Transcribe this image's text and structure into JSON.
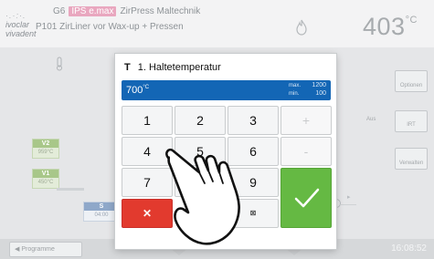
{
  "header": {
    "logo_line1": "ivoclar",
    "logo_line2": "vivadent",
    "program_prefix": "G6",
    "brand_badge": "IPS e.max",
    "program_title": "ZirPress Maltechnik",
    "program_number": "P101",
    "program_subtitle": "ZirLiner vor Wax-up + Pressen",
    "furnace_temp": "403",
    "furnace_temp_unit": "°C"
  },
  "sidebar": {
    "options_label": "Optionen",
    "irt_label": "IRT",
    "manage_label": "Verwalten",
    "aus_label": "Aus"
  },
  "steps": {
    "v2_tag": "V2",
    "v2_value": "959°C",
    "v1_tag": "V1",
    "v1_value": "450°C",
    "s_tag": "S",
    "s_value": "04:00"
  },
  "footer": {
    "programs_label": "◀ Programme",
    "time": "16:08:52"
  },
  "dialog": {
    "title_symbol": "T",
    "title": "1. Haltetemperatur",
    "current_value": "700",
    "current_unit": "°C",
    "max_label": "max.",
    "max_value": "1200",
    "min_label": "min.",
    "min_value": "100",
    "keys": {
      "k1": "1",
      "k2": "2",
      "k3": "3",
      "plus": "+",
      "k4": "4",
      "k5": "5",
      "k6": "6",
      "minus": "-",
      "k7": "7",
      "k8": "8",
      "k9": "9",
      "cancel": "✕",
      "backspace": "⊠"
    }
  },
  "colors": {
    "value_bar": "#1366b5",
    "ok_button": "#65b943",
    "cancel_button": "#e23a2e",
    "brand_badge": "#e9a7bf"
  }
}
